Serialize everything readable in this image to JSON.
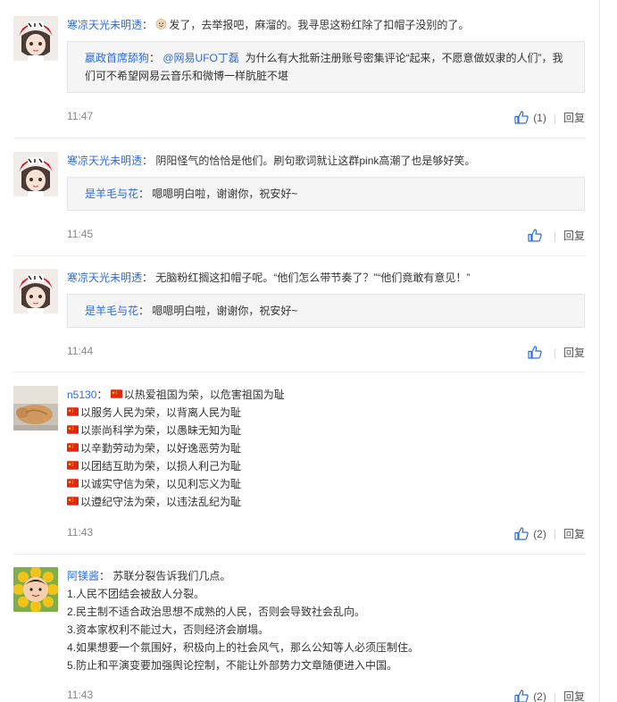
{
  "comments": [
    {
      "user": "寒凉天光未明透",
      "text": "发了，去举报吧，麻溜的。我寻思这粉红除了扣帽子没别的了。",
      "reply": {
        "user": "嬴政首席舔狗",
        "mention": "@网易UFO丁磊",
        "text_line1": "为什么有大批新注册账号密集评论“起来，不愿意做奴隶的人们”，我",
        "text_line2": "们可不希望网易云音乐和微博一样肮脏不堪"
      },
      "time": "11:47",
      "likes": "(1)",
      "reply_label": "回复"
    },
    {
      "user": "寒凉天光未明透",
      "text": "阴阳怪气的恰恰是他们。刷句歌词就让这群pink高潮了也是够好笑。",
      "reply": {
        "user": "是羊毛与花",
        "text": "嗯嗯明白啦，谢谢你，祝安好~"
      },
      "time": "11:45",
      "likes": "",
      "reply_label": "回复"
    },
    {
      "user": "寒凉天光未明透",
      "text": "无脑粉红搁这扣帽子呢。“他们怎么带节奏了？”“他们竟敢有意见！”",
      "reply": {
        "user": "是羊毛与花",
        "text": "嗯嗯明白啦，谢谢你，祝安好~"
      },
      "time": "11:44",
      "likes": "",
      "reply_label": "回复"
    },
    {
      "user": "n5130",
      "lines": [
        "以热爱祖国为荣，以危害祖国为耻",
        "以服务人民为荣，以背离人民为耻",
        "以崇尚科学为荣，以愚昧无知为耻",
        "以辛勤劳动为荣，以好逸恶劳为耻",
        "以团结互助为荣，以损人利己为耻",
        "以诚实守信为荣，以见利忘义为耻",
        "以遵纪守法为荣，以违法乱纪为耻"
      ],
      "time": "11:43",
      "likes": "(2)",
      "reply_label": "回复"
    },
    {
      "user": "阿镁酱",
      "lines": [
        "苏联分裂告诉我们几点。",
        "1.人民不团结会被敌人分裂。",
        "2.民主制不适合政治思想不成熟的人民，否则会导致社会乱向。",
        "3.资本家权利不能过大，否则经济会崩塌。",
        "4.如果想要一个氛围好，积极向上的社会风气，那么公知等人必须压制住。",
        "5.防止和平演变要加强舆论控制，不能让外部势力文章随便进入中国。"
      ],
      "time": "11:43",
      "likes": "(2)",
      "reply_label": "回复"
    }
  ],
  "icons": {
    "like": "thumbs-up-icon",
    "emoji_face": "smiley-face-icon",
    "flag": "china-flag-icon"
  },
  "colors": {
    "link": "#2e6dd6",
    "like_icon": "#2e6dd6",
    "flag_red": "#de2910",
    "flag_star": "#ffde00"
  }
}
